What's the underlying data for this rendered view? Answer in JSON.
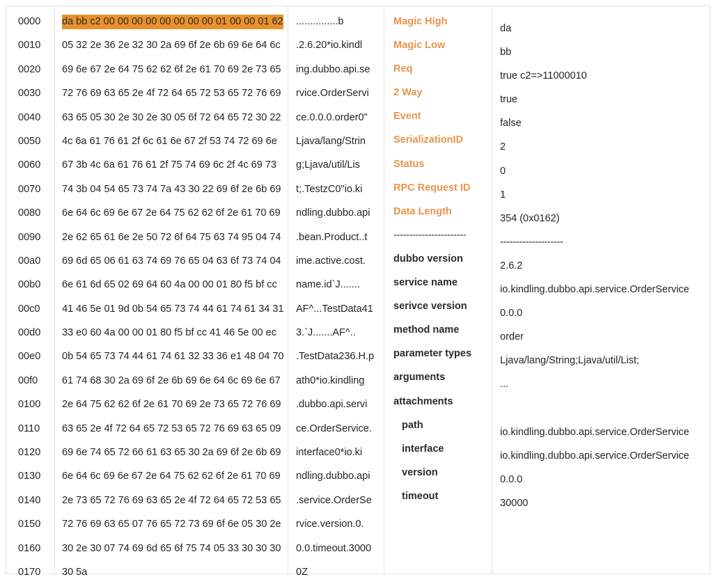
{
  "viewer": {
    "title": "Dubbo Packet Hex Dump Viewer",
    "highlight_color": "#e8912d",
    "accent_label_color": "#e8954a",
    "border_color": "#e3e3e3"
  },
  "hexdump": {
    "highlighted_row_index": 0,
    "rows": [
      {
        "offset": "0000",
        "bytes": "da bb c2 00 00 00 00 00 00 00 00 01 00 00 01 62",
        "ascii": "...............b"
      },
      {
        "offset": "0010",
        "bytes": "05 32 2e 36 2e 32 30 2a 69 6f 2e 6b 69 6e 64 6c",
        "ascii": ".2.6.20*io.kindl"
      },
      {
        "offset": "0020",
        "bytes": "69 6e 67 2e 64 75 62 62 6f 2e 61 70 69 2e 73 65",
        "ascii": "ing.dubbo.api.se"
      },
      {
        "offset": "0030",
        "bytes": "72 76 69 63 65 2e 4f 72 64 65 72 53 65 72 76 69",
        "ascii": "rvice.OrderServi"
      },
      {
        "offset": "0040",
        "bytes": "63 65 05 30 2e 30 2e 30 05 6f 72 64 65 72 30 22",
        "ascii": "ce.0.0.0.order0\""
      },
      {
        "offset": "0050",
        "bytes": "4c 6a 61 76 61 2f 6c 61 6e 67 2f 53 74 72 69 6e",
        "ascii": "Ljava/lang/Strin"
      },
      {
        "offset": "0060",
        "bytes": "67 3b 4c 6a 61 76 61 2f 75 74 69 6c 2f 4c 69 73",
        "ascii": "g;Ljava/util/Lis"
      },
      {
        "offset": "0070",
        "bytes": "74 3b 04 54 65 73 74 7a 43 30 22 69 6f 2e 6b 69",
        "ascii": "t;.TestzC0\"io.ki"
      },
      {
        "offset": "0080",
        "bytes": "6e 64 6c 69 6e 67 2e 64 75 62 62 6f 2e 61 70 69",
        "ascii": "ndling.dubbo.api"
      },
      {
        "offset": "0090",
        "bytes": "2e 62 65 61 6e 2e 50 72 6f 64 75 63 74 95 04 74",
        "ascii": ".bean.Product..t"
      },
      {
        "offset": "00a0",
        "bytes": "69 6d 65 06 61 63 74 69 76 65 04 63 6f 73 74 04",
        "ascii": "ime.active.cost."
      },
      {
        "offset": "00b0",
        "bytes": "6e 61 6d 65 02 69 64 60 4a 00 00 01 80 f5 bf cc",
        "ascii": "name.id`J......."
      },
      {
        "offset": "00c0",
        "bytes": "41 46 5e 01 9d 0b 54 65 73 74 44 61 74 61 34 31",
        "ascii": "AF^...TestData41"
      },
      {
        "offset": "00d0",
        "bytes": "33 e0 60 4a 00 00 01 80 f5 bf cc 41 46 5e 00 ec",
        "ascii": "3.`J.......AF^.."
      },
      {
        "offset": "00e0",
        "bytes": "0b 54 65 73 74 44 61 74 61 32 33 36 e1 48 04 70",
        "ascii": ".TestData236.H.p"
      },
      {
        "offset": "00f0",
        "bytes": "61 74 68 30 2a 69 6f 2e 6b 69 6e 64 6c 69 6e 67",
        "ascii": "ath0*io.kindling"
      },
      {
        "offset": "0100",
        "bytes": "2e 64 75 62 62 6f 2e 61 70 69 2e 73 65 72 76 69",
        "ascii": ".dubbo.api.servi"
      },
      {
        "offset": "0110",
        "bytes": "63 65 2e 4f 72 64 65 72 53 65 72 76 69 63 65 09",
        "ascii": "ce.OrderService."
      },
      {
        "offset": "0120",
        "bytes": "69 6e 74 65 72 66 61 63 65 30 2a 69 6f 2e 6b 69",
        "ascii": "interface0*io.ki"
      },
      {
        "offset": "0130",
        "bytes": "6e 64 6c 69 6e 67 2e 64 75 62 62 6f 2e 61 70 69",
        "ascii": "ndling.dubbo.api"
      },
      {
        "offset": "0140",
        "bytes": "2e 73 65 72 76 69 63 65 2e 4f 72 64 65 72 53 65",
        "ascii": ".service.OrderSe"
      },
      {
        "offset": "0150",
        "bytes": "72 76 69 63 65 07 76 65 72 73 69 6f 6e 05 30 2e",
        "ascii": "rvice.version.0."
      },
      {
        "offset": "0160",
        "bytes": "30 2e 30 07 74 69 6d 65 6f 75 74 05 33 30 30 30",
        "ascii": "0.0.timeout.3000"
      },
      {
        "offset": "0170",
        "bytes": "30 5a",
        "ascii": "0Z"
      }
    ]
  },
  "fields": {
    "rows": [
      {
        "label": "Magic High",
        "value": "da",
        "style": "accent"
      },
      {
        "label": "Magic Low",
        "value": "bb",
        "style": "accent"
      },
      {
        "label": "Req",
        "value": "true  c2=>11000010",
        "style": "accent"
      },
      {
        "label": "2 Way",
        "value": "true",
        "style": "accent"
      },
      {
        "label": "Event",
        "value": "false",
        "style": "accent"
      },
      {
        "label": "SerializationID",
        "value": "2",
        "style": "accent"
      },
      {
        "label": "Status",
        "value": "0",
        "style": "accent"
      },
      {
        "label": "RPC Request ID",
        "value": "1",
        "style": "accent"
      },
      {
        "label": "Data Length",
        "value": "354 (0x0162)",
        "style": "accent"
      },
      {
        "label": "-----------------------",
        "value": "--------------------",
        "style": "separator"
      },
      {
        "label": "dubbo version",
        "value": "2.6.2",
        "style": "plain"
      },
      {
        "label": "service name",
        "value": "io.kindling.dubbo.api.service.OrderService",
        "style": "plain"
      },
      {
        "label": "serivce version",
        "value": "0.0.0",
        "style": "plain"
      },
      {
        "label": "method name",
        "value": "order",
        "style": "plain"
      },
      {
        "label": "parameter types",
        "value": "Ljava/lang/String;Ljava/util/List;",
        "style": "plain"
      },
      {
        "label": "arguments",
        "value": "...",
        "style": "plain"
      },
      {
        "label": "attachments",
        "value": "",
        "style": "plain"
      },
      {
        "label": "path",
        "value": "io.kindling.dubbo.api.service.OrderService",
        "style": "indent"
      },
      {
        "label": "interface",
        "value": "io.kindling.dubbo.api.service.OrderService",
        "style": "indent"
      },
      {
        "label": "version",
        "value": "0.0.0",
        "style": "indent"
      },
      {
        "label": "timeout",
        "value": "30000",
        "style": "indent"
      }
    ]
  }
}
